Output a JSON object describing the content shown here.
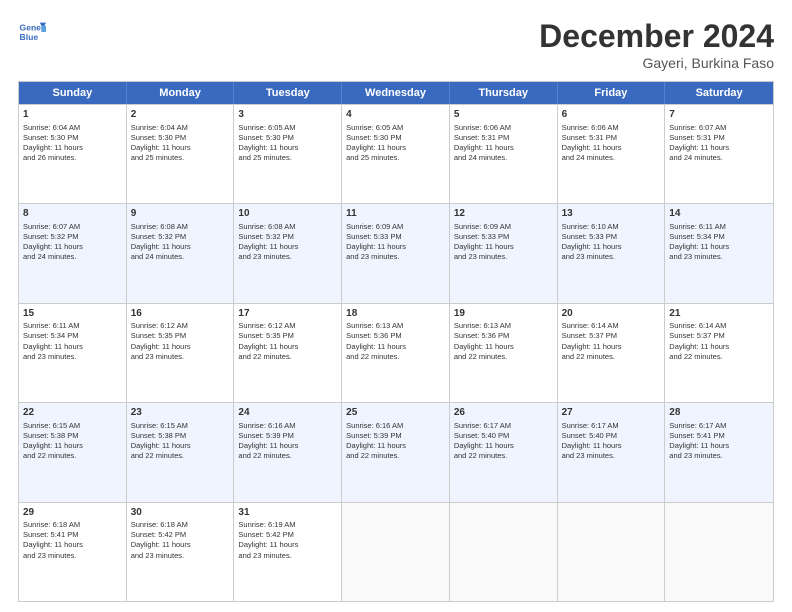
{
  "logo": {
    "line1": "General",
    "line2": "Blue"
  },
  "title": "December 2024",
  "location": "Gayeri, Burkina Faso",
  "header_days": [
    "Sunday",
    "Monday",
    "Tuesday",
    "Wednesday",
    "Thursday",
    "Friday",
    "Saturday"
  ],
  "weeks": [
    [
      {
        "day": "1",
        "lines": [
          "Sunrise: 6:04 AM",
          "Sunset: 5:30 PM",
          "Daylight: 11 hours",
          "and 26 minutes."
        ]
      },
      {
        "day": "2",
        "lines": [
          "Sunrise: 6:04 AM",
          "Sunset: 5:30 PM",
          "Daylight: 11 hours",
          "and 25 minutes."
        ]
      },
      {
        "day": "3",
        "lines": [
          "Sunrise: 6:05 AM",
          "Sunset: 5:30 PM",
          "Daylight: 11 hours",
          "and 25 minutes."
        ]
      },
      {
        "day": "4",
        "lines": [
          "Sunrise: 6:05 AM",
          "Sunset: 5:30 PM",
          "Daylight: 11 hours",
          "and 25 minutes."
        ]
      },
      {
        "day": "5",
        "lines": [
          "Sunrise: 6:06 AM",
          "Sunset: 5:31 PM",
          "Daylight: 11 hours",
          "and 24 minutes."
        ]
      },
      {
        "day": "6",
        "lines": [
          "Sunrise: 6:06 AM",
          "Sunset: 5:31 PM",
          "Daylight: 11 hours",
          "and 24 minutes."
        ]
      },
      {
        "day": "7",
        "lines": [
          "Sunrise: 6:07 AM",
          "Sunset: 5:31 PM",
          "Daylight: 11 hours",
          "and 24 minutes."
        ]
      }
    ],
    [
      {
        "day": "8",
        "lines": [
          "Sunrise: 6:07 AM",
          "Sunset: 5:32 PM",
          "Daylight: 11 hours",
          "and 24 minutes."
        ]
      },
      {
        "day": "9",
        "lines": [
          "Sunrise: 6:08 AM",
          "Sunset: 5:32 PM",
          "Daylight: 11 hours",
          "and 24 minutes."
        ]
      },
      {
        "day": "10",
        "lines": [
          "Sunrise: 6:08 AM",
          "Sunset: 5:32 PM",
          "Daylight: 11 hours",
          "and 23 minutes."
        ]
      },
      {
        "day": "11",
        "lines": [
          "Sunrise: 6:09 AM",
          "Sunset: 5:33 PM",
          "Daylight: 11 hours",
          "and 23 minutes."
        ]
      },
      {
        "day": "12",
        "lines": [
          "Sunrise: 6:09 AM",
          "Sunset: 5:33 PM",
          "Daylight: 11 hours",
          "and 23 minutes."
        ]
      },
      {
        "day": "13",
        "lines": [
          "Sunrise: 6:10 AM",
          "Sunset: 5:33 PM",
          "Daylight: 11 hours",
          "and 23 minutes."
        ]
      },
      {
        "day": "14",
        "lines": [
          "Sunrise: 6:11 AM",
          "Sunset: 5:34 PM",
          "Daylight: 11 hours",
          "and 23 minutes."
        ]
      }
    ],
    [
      {
        "day": "15",
        "lines": [
          "Sunrise: 6:11 AM",
          "Sunset: 5:34 PM",
          "Daylight: 11 hours",
          "and 23 minutes."
        ]
      },
      {
        "day": "16",
        "lines": [
          "Sunrise: 6:12 AM",
          "Sunset: 5:35 PM",
          "Daylight: 11 hours",
          "and 23 minutes."
        ]
      },
      {
        "day": "17",
        "lines": [
          "Sunrise: 6:12 AM",
          "Sunset: 5:35 PM",
          "Daylight: 11 hours",
          "and 22 minutes."
        ]
      },
      {
        "day": "18",
        "lines": [
          "Sunrise: 6:13 AM",
          "Sunset: 5:36 PM",
          "Daylight: 11 hours",
          "and 22 minutes."
        ]
      },
      {
        "day": "19",
        "lines": [
          "Sunrise: 6:13 AM",
          "Sunset: 5:36 PM",
          "Daylight: 11 hours",
          "and 22 minutes."
        ]
      },
      {
        "day": "20",
        "lines": [
          "Sunrise: 6:14 AM",
          "Sunset: 5:37 PM",
          "Daylight: 11 hours",
          "and 22 minutes."
        ]
      },
      {
        "day": "21",
        "lines": [
          "Sunrise: 6:14 AM",
          "Sunset: 5:37 PM",
          "Daylight: 11 hours",
          "and 22 minutes."
        ]
      }
    ],
    [
      {
        "day": "22",
        "lines": [
          "Sunrise: 6:15 AM",
          "Sunset: 5:38 PM",
          "Daylight: 11 hours",
          "and 22 minutes."
        ]
      },
      {
        "day": "23",
        "lines": [
          "Sunrise: 6:15 AM",
          "Sunset: 5:38 PM",
          "Daylight: 11 hours",
          "and 22 minutes."
        ]
      },
      {
        "day": "24",
        "lines": [
          "Sunrise: 6:16 AM",
          "Sunset: 5:39 PM",
          "Daylight: 11 hours",
          "and 22 minutes."
        ]
      },
      {
        "day": "25",
        "lines": [
          "Sunrise: 6:16 AM",
          "Sunset: 5:39 PM",
          "Daylight: 11 hours",
          "and 22 minutes."
        ]
      },
      {
        "day": "26",
        "lines": [
          "Sunrise: 6:17 AM",
          "Sunset: 5:40 PM",
          "Daylight: 11 hours",
          "and 22 minutes."
        ]
      },
      {
        "day": "27",
        "lines": [
          "Sunrise: 6:17 AM",
          "Sunset: 5:40 PM",
          "Daylight: 11 hours",
          "and 23 minutes."
        ]
      },
      {
        "day": "28",
        "lines": [
          "Sunrise: 6:17 AM",
          "Sunset: 5:41 PM",
          "Daylight: 11 hours",
          "and 23 minutes."
        ]
      }
    ],
    [
      {
        "day": "29",
        "lines": [
          "Sunrise: 6:18 AM",
          "Sunset: 5:41 PM",
          "Daylight: 11 hours",
          "and 23 minutes."
        ]
      },
      {
        "day": "30",
        "lines": [
          "Sunrise: 6:18 AM",
          "Sunset: 5:42 PM",
          "Daylight: 11 hours",
          "and 23 minutes."
        ]
      },
      {
        "day": "31",
        "lines": [
          "Sunrise: 6:19 AM",
          "Sunset: 5:42 PM",
          "Daylight: 11 hours",
          "and 23 minutes."
        ]
      },
      {
        "day": "",
        "lines": []
      },
      {
        "day": "",
        "lines": []
      },
      {
        "day": "",
        "lines": []
      },
      {
        "day": "",
        "lines": []
      }
    ]
  ],
  "alt_rows": [
    1,
    3
  ]
}
